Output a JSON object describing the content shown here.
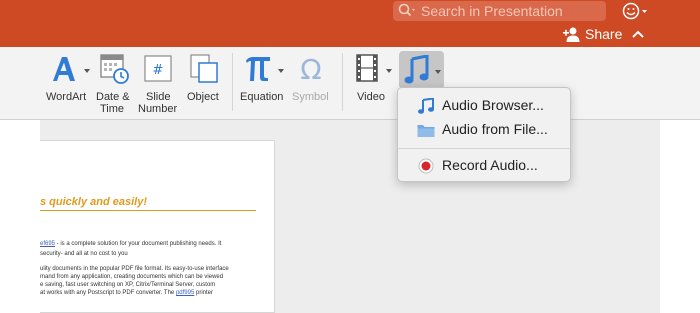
{
  "search": {
    "placeholder": "Search in Presentation",
    "icon": "search-icon"
  },
  "header": {
    "share_label": "Share",
    "accent": "#cd4a24"
  },
  "ribbon": {
    "wordart": "WordArt",
    "datetime_line1": "Date &",
    "datetime_line2": "Time",
    "slidenum_line1": "Slide",
    "slidenum_line2": "Number",
    "object": "Object",
    "equation": "Equation",
    "symbol": "Symbol",
    "video": "Video",
    "audio_icon": "music-note-icon"
  },
  "audio_menu": {
    "items": [
      {
        "label": "Audio Browser...",
        "icon": "music-note-icon"
      },
      {
        "label": "Audio from File...",
        "icon": "folder-icon"
      },
      {
        "label": "Record Audio...",
        "icon": "record-icon"
      }
    ]
  },
  "document": {
    "heading": "s quickly and easily!",
    "lines": [
      "ef695 - is a complete solution for your document publishing needs. It",
      "security- and all at no cost to you",
      "ulity documents in the popular PDF file format. Its easy-to-use interface",
      "mand from any application, creating documents which can be viewed",
      "e saving, fast user switching on XP, Citrix/Terminal Server, custom",
      "at works with any Postscript to PDF converter. The pdf995 printer"
    ]
  }
}
